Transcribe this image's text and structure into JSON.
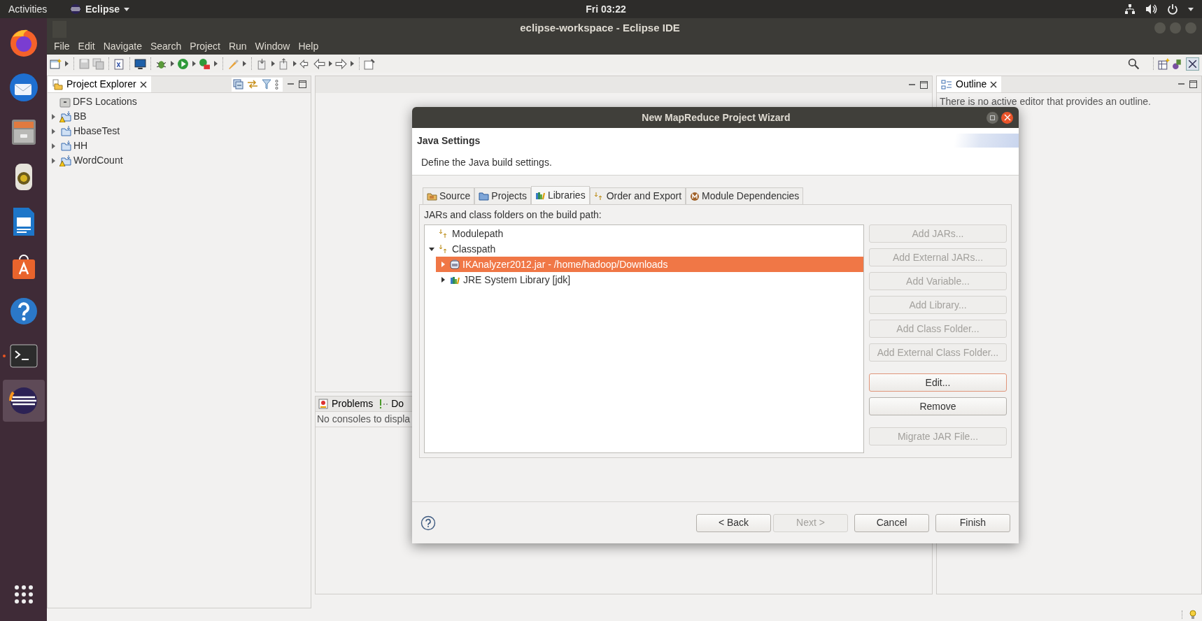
{
  "top_bar": {
    "activities": "Activities",
    "app_menu": "Eclipse",
    "clock": "Fri 03:22"
  },
  "dock": {
    "items": [
      {
        "kind": "browser",
        "selected": false,
        "running": false
      },
      {
        "kind": "mail",
        "selected": false,
        "running": false
      },
      {
        "kind": "files",
        "selected": false,
        "running": false
      },
      {
        "kind": "speaker",
        "selected": false,
        "running": false
      },
      {
        "kind": "document",
        "selected": false,
        "running": false
      },
      {
        "kind": "store",
        "selected": false,
        "running": false
      },
      {
        "kind": "help",
        "selected": false,
        "running": false
      },
      {
        "kind": "terminal",
        "selected": false,
        "running": true
      },
      {
        "kind": "eclipse",
        "selected": true,
        "running": false
      }
    ]
  },
  "window": {
    "title": "eclipse-workspace - Eclipse IDE"
  },
  "menu": [
    "File",
    "Edit",
    "Navigate",
    "Search",
    "Project",
    "Run",
    "Window",
    "Help"
  ],
  "project_explorer": {
    "title": "Project Explorer",
    "items": [
      {
        "label": "DFS Locations",
        "kind": "dfs"
      },
      {
        "label": "BB",
        "kind": "project",
        "warning": true
      },
      {
        "label": "HbaseTest",
        "kind": "project",
        "warning": false
      },
      {
        "label": "HH",
        "kind": "project",
        "warning": false
      },
      {
        "label": "WordCount",
        "kind": "project",
        "warning": true
      }
    ]
  },
  "outline": {
    "title": "Outline",
    "message": "There is no active editor that provides an outline."
  },
  "bottom_panel": {
    "tabs": [
      "Problems",
      "Do"
    ],
    "message": "No consoles to displa"
  },
  "dialog": {
    "title": "New MapReduce Project Wizard",
    "heading": "Java Settings",
    "description": "Define the Java build settings.",
    "tabs": [
      {
        "label": "Source",
        "kind": "source",
        "selected": false
      },
      {
        "label": "Projects",
        "kind": "projects",
        "selected": false
      },
      {
        "label": "Libraries",
        "kind": "libraries",
        "selected": true
      },
      {
        "label": "Order and Export",
        "kind": "order",
        "selected": false
      },
      {
        "label": "Module Dependencies",
        "kind": "module",
        "selected": false
      }
    ],
    "tree_label": "JARs and class folders on the build path:",
    "tree": [
      {
        "label": "Modulepath",
        "kind": "container",
        "expandable": false,
        "selected": false
      },
      {
        "label": "Classpath",
        "kind": "container",
        "expandable": true,
        "expanded": true,
        "selected": false,
        "children": [
          {
            "label": "IKAnalyzer2012.jar - /home/hadoop/Downloads",
            "kind": "jar",
            "expandable": true,
            "expanded": false,
            "selected": true
          },
          {
            "label": "JRE System Library [jdk]",
            "kind": "library",
            "expandable": true,
            "expanded": false,
            "selected": false
          }
        ]
      }
    ],
    "button_groups": [
      [
        {
          "label": "Add JARs...",
          "disabled": true,
          "focused": false
        },
        {
          "label": "Add External JARs...",
          "disabled": true,
          "focused": false
        },
        {
          "label": "Add Variable...",
          "disabled": true,
          "focused": false
        },
        {
          "label": "Add Library...",
          "disabled": true,
          "focused": false
        },
        {
          "label": "Add Class Folder...",
          "disabled": true,
          "focused": false
        },
        {
          "label": "Add External Class Folder...",
          "disabled": true,
          "focused": false
        }
      ],
      [
        {
          "label": "Edit...",
          "disabled": false,
          "focused": true
        },
        {
          "label": "Remove",
          "disabled": false,
          "focused": false
        }
      ],
      [
        {
          "label": "Migrate JAR File...",
          "disabled": true,
          "focused": false
        }
      ]
    ],
    "footer_buttons": [
      {
        "label": "< Back",
        "disabled": false
      },
      {
        "label": "Next >",
        "disabled": true
      },
      {
        "label": "Cancel",
        "disabled": false
      },
      {
        "label": "Finish",
        "disabled": false
      }
    ]
  }
}
